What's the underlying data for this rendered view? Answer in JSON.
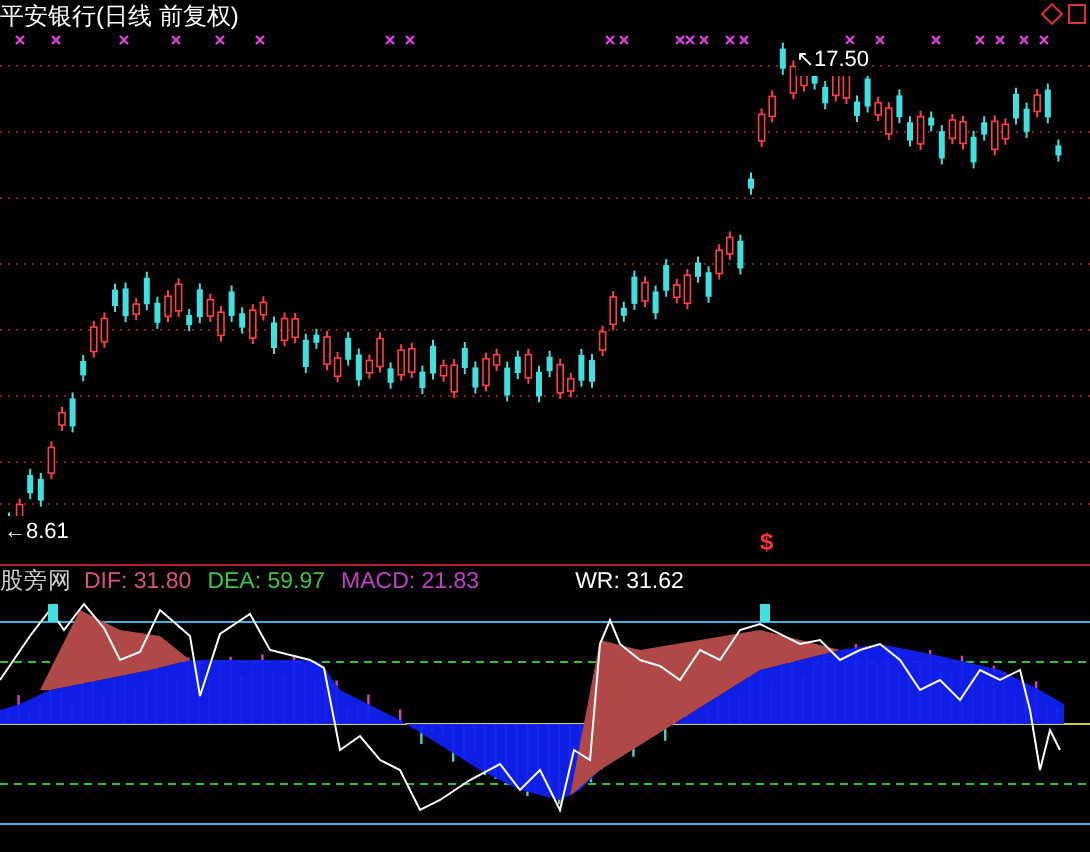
{
  "chart_title": "平安银行(日线 前复权)",
  "price_labels": [
    {
      "kind": "high",
      "text": "↖17.50"
    },
    {
      "kind": "low",
      "text": "←8.61"
    }
  ],
  "signal_mark": "$",
  "indicator": {
    "name": "股旁网",
    "values": [
      {
        "text": "DIF: 31.80",
        "color": "#d9508a"
      },
      {
        "text": "DEA: 59.97",
        "color": "#3cc83c"
      },
      {
        "text": "MACD: 21.83",
        "color": "#c040c8"
      },
      {
        "text": "WR: 31.62",
        "color": "#ffffff"
      }
    ]
  }
}
